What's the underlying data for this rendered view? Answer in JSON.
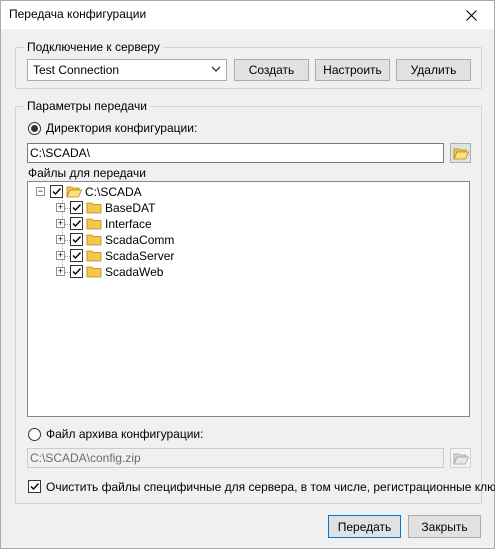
{
  "window": {
    "title": "Передача конфигурации"
  },
  "connection": {
    "group_title": "Подключение к серверу",
    "selected": "Test Connection",
    "create_label": "Создать",
    "configure_label": "Настроить",
    "delete_label": "Удалить"
  },
  "params": {
    "group_title": "Параметры передачи",
    "config_dir_label": "Директория конфигурации:",
    "config_dir_value": "C:\\SCADA\\",
    "config_dir_selected": true,
    "files_label": "Файлы для передачи",
    "tree": {
      "root": {
        "label": "C:\\SCADA",
        "checked": true,
        "expanded": true
      },
      "children": [
        {
          "label": "BaseDAT",
          "checked": true
        },
        {
          "label": "Interface",
          "checked": true
        },
        {
          "label": "ScadaComm",
          "checked": true
        },
        {
          "label": "ScadaServer",
          "checked": true
        },
        {
          "label": "ScadaWeb",
          "checked": true
        }
      ]
    },
    "archive_label": "Файл архива конфигурации:",
    "archive_value": "C:\\SCADA\\config.zip",
    "archive_selected": false,
    "clear_label": "Очистить файлы специфичные для сервера, в том числе, регистрационные ключи",
    "clear_checked": true
  },
  "footer": {
    "transfer_label": "Передать",
    "close_label": "Закрыть"
  },
  "colors": {
    "folder": "#f4c84a",
    "accent": "#0078d7"
  }
}
